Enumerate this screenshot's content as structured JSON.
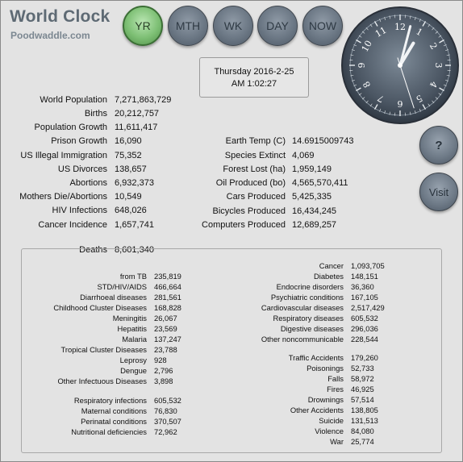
{
  "brand": {
    "title": "World Clock",
    "subtitle": "Poodwaddle.com"
  },
  "nav": [
    {
      "label": "YR",
      "active": true
    },
    {
      "label": "MTH",
      "active": false
    },
    {
      "label": "WK",
      "active": false
    },
    {
      "label": "DAY",
      "active": false
    },
    {
      "label": "NOW",
      "active": false
    }
  ],
  "datetime": {
    "date": "Thursday 2016-2-25",
    "time": "AM 1:02:27"
  },
  "clock": {
    "hour": 1,
    "minute": 2,
    "second": 27,
    "numerals": [
      "12",
      "1",
      "2",
      "3",
      "4",
      "5",
      "6",
      "7",
      "8",
      "9",
      "10",
      "11"
    ]
  },
  "side_buttons": {
    "help": "?",
    "visit": "Visit"
  },
  "stats_left": [
    {
      "label": "World Population",
      "value": "7,271,863,729"
    },
    {
      "label": "Births",
      "value": "20,212,757"
    },
    {
      "label": "Population Growth",
      "value": "11,611,417"
    },
    {
      "label": "Prison Growth",
      "value": "16,090"
    },
    {
      "label": "US Illegal Immigration",
      "value": "75,352"
    },
    {
      "label": "US Divorces",
      "value": "138,657"
    },
    {
      "label": "Abortions",
      "value": "6,932,373"
    },
    {
      "label": "Mothers Die/Abortions",
      "value": "10,549"
    },
    {
      "label": "HIV Infections",
      "value": "648,026"
    },
    {
      "label": "Cancer Incidence",
      "value": "1,657,741"
    }
  ],
  "stats_right": [
    {
      "label": "Earth Temp (C)",
      "value": "14.6915009743"
    },
    {
      "label": "Species Extinct",
      "value": "4,069"
    },
    {
      "label": "Forest Lost (ha)",
      "value": "1,959,149"
    },
    {
      "label": "Oil Produced (bo)",
      "value": "4,565,570,411"
    },
    {
      "label": "Cars Produced",
      "value": "5,425,335"
    },
    {
      "label": "Bicycles Produced",
      "value": "16,434,245"
    },
    {
      "label": "Computers Produced",
      "value": "12,689,257"
    }
  ],
  "deaths": {
    "label": "Deaths",
    "total": "8,601,340",
    "left": [
      {
        "label": "from TB",
        "value": "235,819"
      },
      {
        "label": "STD/HIV/AIDS",
        "value": "466,664"
      },
      {
        "label": "Diarrhoeal diseases",
        "value": "281,561"
      },
      {
        "label": "Childhood Cluster Diseases",
        "value": "168,828"
      },
      {
        "label": "Meningitis",
        "value": "26,067"
      },
      {
        "label": "Hepatitis",
        "value": "23,569"
      },
      {
        "label": "Malaria",
        "value": "137,247"
      },
      {
        "label": "Tropical Cluster Diseases",
        "value": "23,788"
      },
      {
        "label": "Leprosy",
        "value": "928"
      },
      {
        "label": "Dengue",
        "value": "2,796"
      },
      {
        "label": "Other Infectuous Diseases",
        "value": "3,898"
      },
      {
        "label": "Respiratory infections",
        "value": "605,532"
      },
      {
        "label": "Maternal conditions",
        "value": "76,830"
      },
      {
        "label": "Perinatal conditions",
        "value": "370,507"
      },
      {
        "label": "Nutritional deficiencies",
        "value": "72,962"
      }
    ],
    "right": [
      {
        "label": "Cancer",
        "value": "1,093,705"
      },
      {
        "label": "Diabetes",
        "value": "148,151"
      },
      {
        "label": "Endocrine disorders",
        "value": "36,360"
      },
      {
        "label": "Psychiatric conditions",
        "value": "167,105"
      },
      {
        "label": "Cardiovascular diseases",
        "value": "2,517,429"
      },
      {
        "label": "Respiratory diseases",
        "value": "605,532"
      },
      {
        "label": "Digestive diseases",
        "value": "296,036"
      },
      {
        "label": "Other noncommunicable",
        "value": "228,544"
      },
      {
        "label": "Traffic Accidents",
        "value": "179,260"
      },
      {
        "label": "Poisonings",
        "value": "52,733"
      },
      {
        "label": "Falls",
        "value": "58,972"
      },
      {
        "label": "Fires",
        "value": "46,925"
      },
      {
        "label": "Drownings",
        "value": "57,514"
      },
      {
        "label": "Other Accidents",
        "value": "138,805"
      },
      {
        "label": "Suicide",
        "value": "131,513"
      },
      {
        "label": "Violence",
        "value": "84,080"
      },
      {
        "label": "War",
        "value": "25,774"
      }
    ]
  }
}
